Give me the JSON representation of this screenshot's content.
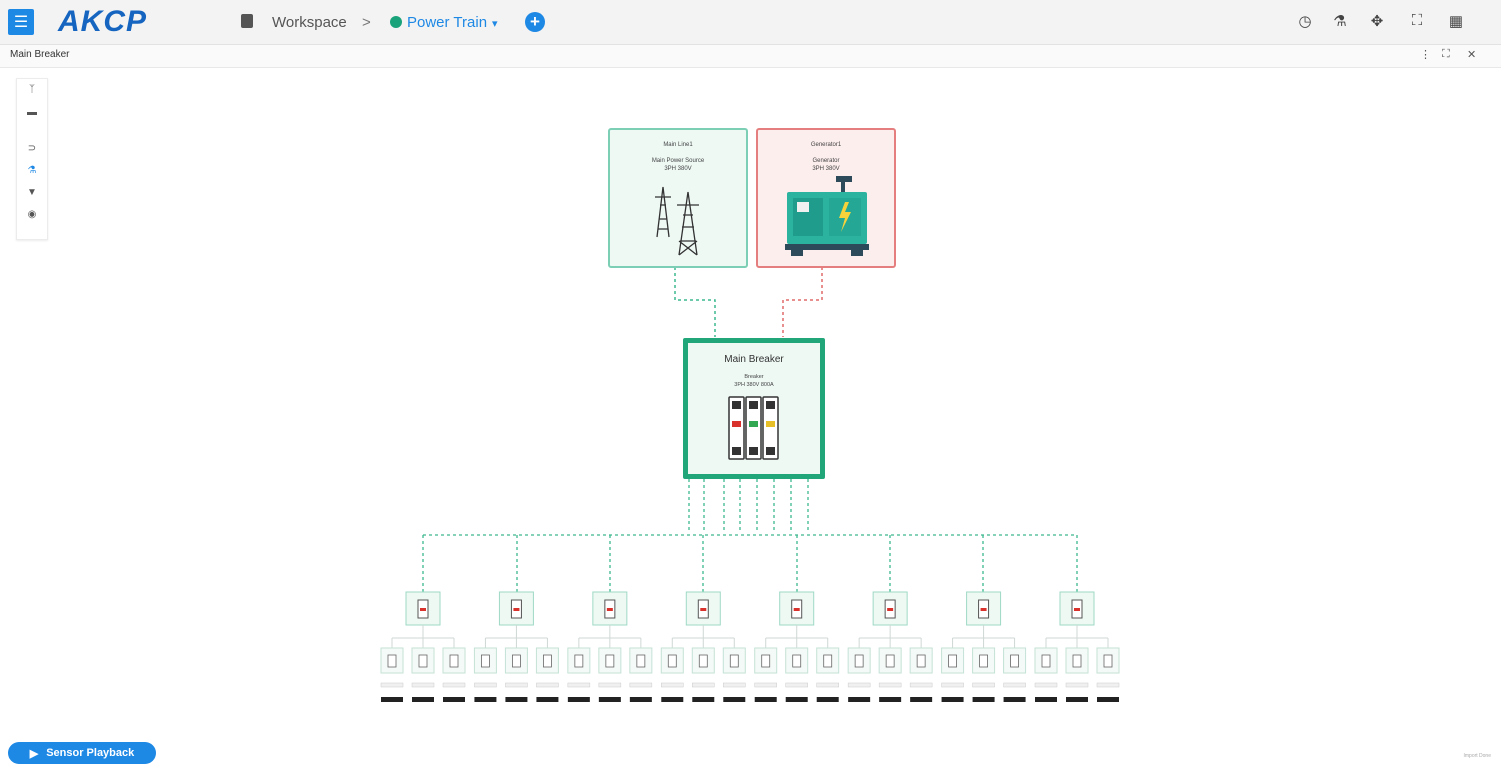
{
  "app": {
    "logo": "AKCP",
    "breadcrumb": {
      "workspace": "Workspace",
      "separator": ">",
      "current": "Power Train",
      "caret": "▾",
      "add": "+"
    },
    "header_icons": [
      "clock-icon",
      "sensor-icon",
      "plug-icon",
      "fullscreen-icon",
      "account-icon"
    ]
  },
  "panel": {
    "title": "Main Breaker",
    "icons": [
      "more-icon",
      "expand-icon",
      "close-icon"
    ]
  },
  "toolbox": {
    "icons": [
      "branch-icon",
      "list-icon",
      "feed-icon",
      "sensor-icon",
      "plug-icon",
      "eye-icon"
    ]
  },
  "diagram": {
    "main_line": {
      "name": "Main Line1",
      "type": "Main Power Source",
      "spec": "3PH 380V"
    },
    "generator": {
      "name": "Generator1",
      "type": "Generator",
      "spec": "3PH 380V"
    },
    "main_breaker": {
      "title": "Main Breaker",
      "type": "Breaker",
      "spec": "3PH 380V 800A"
    },
    "sub_breakers": 8,
    "outlets_per_breaker": 3
  },
  "footer": {
    "playback": "Sensor Playback",
    "right_text": "Import Done"
  },
  "colors": {
    "accent": "#1e88e5",
    "ok": "#21a67a",
    "alert": "#e57f7f"
  }
}
